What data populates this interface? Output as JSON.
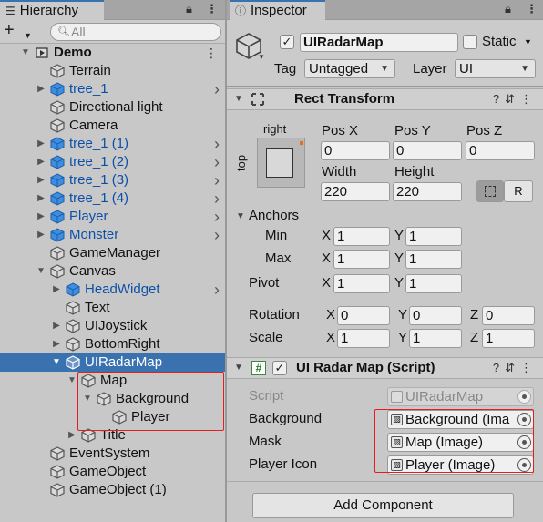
{
  "hierarchy": {
    "tab_label": "Hierarchy",
    "search_placeholder": "All",
    "add_button": "+",
    "items": [
      {
        "label": "Demo"
      },
      {
        "label": "Terrain"
      },
      {
        "label": "tree_1"
      },
      {
        "label": "Directional light"
      },
      {
        "label": "Camera"
      },
      {
        "label": "tree_1 (1)"
      },
      {
        "label": "tree_1 (2)"
      },
      {
        "label": "tree_1 (3)"
      },
      {
        "label": "tree_1 (4)"
      },
      {
        "label": "Player"
      },
      {
        "label": "Monster"
      },
      {
        "label": "GameManager"
      },
      {
        "label": "Canvas"
      },
      {
        "label": "HeadWidget"
      },
      {
        "label": "Text"
      },
      {
        "label": "UIJoystick"
      },
      {
        "label": "BottomRight"
      },
      {
        "label": "UIRadarMap"
      },
      {
        "label": "Map"
      },
      {
        "label": "Background"
      },
      {
        "label": "Player"
      },
      {
        "label": "Title"
      },
      {
        "label": "EventSystem"
      },
      {
        "label": "GameObject"
      },
      {
        "label": "GameObject (1)"
      }
    ]
  },
  "inspector": {
    "tab_label": "Inspector",
    "object_name": "UIRadarMap",
    "static_label": "Static",
    "tag_label": "Tag",
    "tag_value": "Untagged",
    "layer_label": "Layer",
    "layer_value": "UI",
    "rect_transform": {
      "title": "Rect Transform",
      "anchor_preset_h": "right",
      "anchor_preset_v": "top",
      "pos_x_label": "Pos X",
      "pos_x": "0",
      "pos_y_label": "Pos Y",
      "pos_y": "0",
      "pos_z_label": "Pos Z",
      "pos_z": "0",
      "width_label": "Width",
      "width": "220",
      "height_label": "Height",
      "height": "220",
      "r_button": "R",
      "anchors_label": "Anchors",
      "min_label": "Min",
      "min_x": "1",
      "min_y": "1",
      "max_label": "Max",
      "max_x": "1",
      "max_y": "1",
      "pivot_label": "Pivot",
      "pivot_x": "1",
      "pivot_y": "1",
      "rotation_label": "Rotation",
      "rot_x": "0",
      "rot_y": "0",
      "rot_z": "0",
      "scale_label": "Scale",
      "scale_x": "1",
      "scale_y": "1",
      "scale_z": "1",
      "axis_x": "X",
      "axis_y": "Y",
      "axis_z": "Z"
    },
    "script_component": {
      "title": "UI Radar Map (Script)",
      "script_label": "Script",
      "script_value": "UIRadarMap",
      "background_label": "Background",
      "background_value": "Background (Ima",
      "mask_label": "Mask",
      "mask_value": "Map (Image)",
      "player_icon_label": "Player Icon",
      "player_icon_value": "Player (Image)"
    },
    "add_component": "Add Component"
  },
  "colors": {
    "selection": "#3a72b0",
    "prefab_blue": "#0c4fa8",
    "highlight_red": "#e02020"
  }
}
